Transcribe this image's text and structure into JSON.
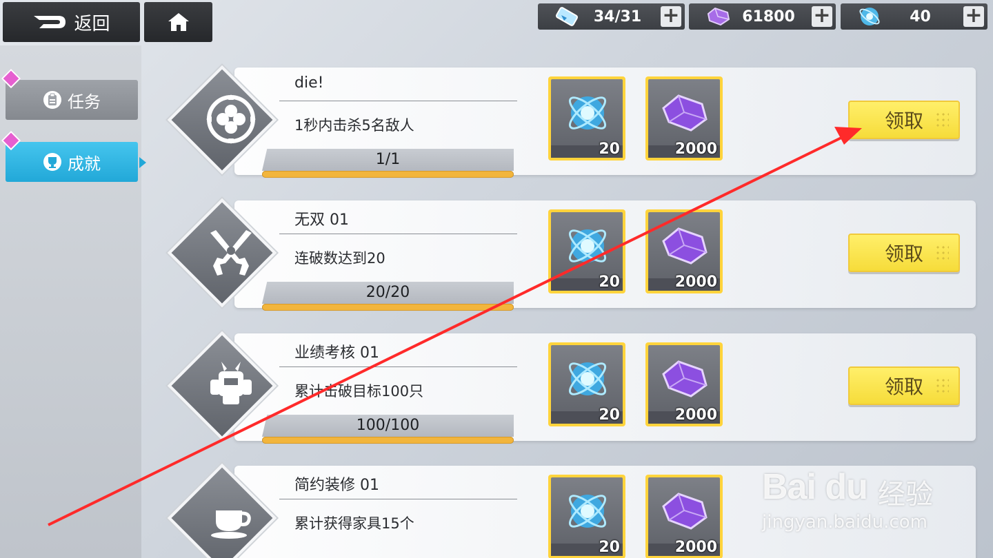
{
  "topbar": {
    "back_label": "返回",
    "resources": [
      {
        "icon": "stamina-icon",
        "value": "34/31"
      },
      {
        "icon": "crystal-icon",
        "value": "61800"
      },
      {
        "icon": "orb-icon",
        "value": "40"
      }
    ],
    "plus_label": "+"
  },
  "sidebar": {
    "tabs": [
      {
        "label": "任务",
        "icon": "clipboard-icon",
        "active": false
      },
      {
        "label": "成就",
        "icon": "trophy-icon",
        "active": true
      }
    ]
  },
  "achievements": [
    {
      "title": "die!",
      "description": "1秒内击杀5名敌人",
      "progress_text": "1/1",
      "progress": 1.0,
      "badge": "clover-icon",
      "rewards": [
        {
          "icon": "orb-icon",
          "amount": "20"
        },
        {
          "icon": "crystal-icon",
          "amount": "2000"
        }
      ],
      "claim_label": "领取"
    },
    {
      "title": "无双 01",
      "description": "连破数达到20",
      "progress_text": "20/20",
      "progress": 1.0,
      "badge": "crossed-pistols-icon",
      "rewards": [
        {
          "icon": "orb-icon",
          "amount": "20"
        },
        {
          "icon": "crystal-icon",
          "amount": "2000"
        }
      ],
      "claim_label": "领取"
    },
    {
      "title": "业绩考核 01",
      "description": "累计击破目标100只",
      "progress_text": "100/100",
      "progress": 1.0,
      "badge": "robot-icon",
      "rewards": [
        {
          "icon": "orb-icon",
          "amount": "20"
        },
        {
          "icon": "crystal-icon",
          "amount": "2000"
        }
      ],
      "claim_label": "领取"
    },
    {
      "title": "简约装修 01",
      "description": "累计获得家具15个",
      "progress_text": "",
      "progress": 0,
      "badge": "coffee-cup-icon",
      "rewards": [
        {
          "icon": "orb-icon",
          "amount": "20"
        },
        {
          "icon": "crystal-icon",
          "amount": "2000"
        }
      ],
      "claim_label": ""
    }
  ],
  "watermark": {
    "brand": "Bai du",
    "sub": "经验",
    "url": "jingyan.baidu.com"
  },
  "colors": {
    "accent_blue": "#22a8d8",
    "claim_yellow": "#f6dc3a",
    "progress_fill": "#f2b53c",
    "arrow_red": "#ff2a2a"
  }
}
